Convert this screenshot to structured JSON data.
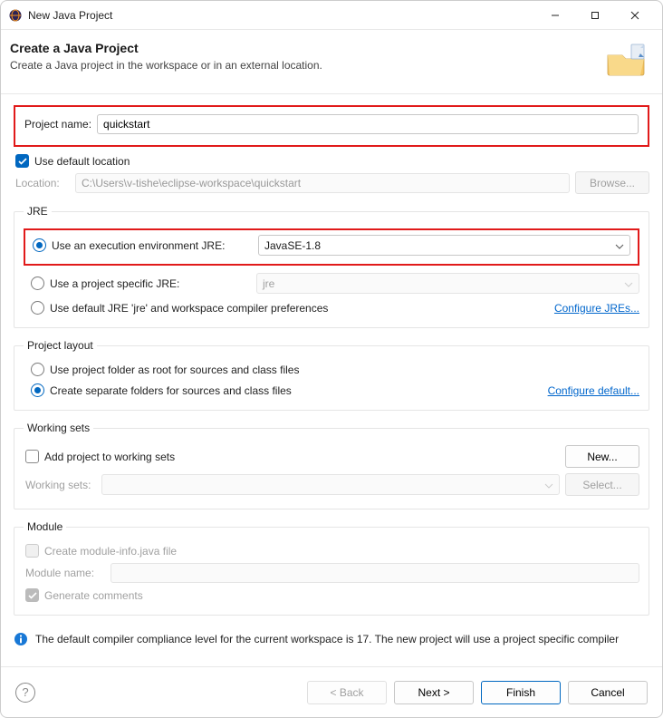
{
  "window": {
    "title": "New Java Project"
  },
  "header": {
    "title": "Create a Java Project",
    "subtitle": "Create a Java project in the workspace or in an external location."
  },
  "project_name": {
    "label": "Project name:",
    "value": "quickstart"
  },
  "default_location": {
    "label": "Use default location",
    "checked": true
  },
  "location": {
    "label": "Location:",
    "value": "C:\\Users\\v-tishe\\eclipse-workspace\\quickstart",
    "browse": "Browse..."
  },
  "jre": {
    "legend": "JRE",
    "exec_env": {
      "label": "Use an execution environment JRE:",
      "value": "JavaSE-1.8",
      "selected": true
    },
    "project_specific": {
      "label": "Use a project specific JRE:",
      "value": "jre",
      "selected": false
    },
    "default_jre": {
      "label": "Use default JRE 'jre' and workspace compiler preferences",
      "selected": false
    },
    "configure_link": "Configure JREs..."
  },
  "layout": {
    "legend": "Project layout",
    "opt_root": {
      "label": "Use project folder as root for sources and class files",
      "selected": false
    },
    "opt_separate": {
      "label": "Create separate folders for sources and class files",
      "selected": true
    },
    "configure_link": "Configure default..."
  },
  "working_sets": {
    "legend": "Working sets",
    "add": {
      "label": "Add project to working sets",
      "checked": false
    },
    "new_btn": "New...",
    "sets_label": "Working sets:",
    "select_btn": "Select..."
  },
  "module": {
    "legend": "Module",
    "create_info": {
      "label": "Create module-info.java file",
      "checked": false
    },
    "name_label": "Module name:",
    "gen_comments": {
      "label": "Generate comments",
      "checked": true
    }
  },
  "info_msg": "The default compiler compliance level for the current workspace is 17. The new project will use a project specific compiler",
  "footer": {
    "back": "< Back",
    "next": "Next >",
    "finish": "Finish",
    "cancel": "Cancel"
  }
}
